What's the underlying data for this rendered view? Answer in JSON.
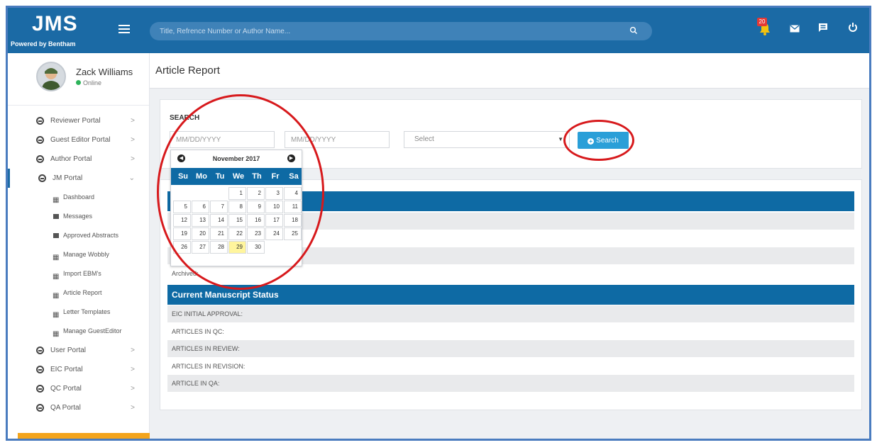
{
  "brand": {
    "title": "JMS",
    "subtitle": "Powered by Bentham"
  },
  "topbar": {
    "search_placeholder": "Title, Refrence Number or Author Name...",
    "icons": [
      "notification-icon",
      "mail-icon",
      "chat-icon",
      "power-icon"
    ],
    "notification_count": "20"
  },
  "user": {
    "name": "Zack Williams",
    "status": "Online"
  },
  "sidebar": {
    "items": [
      {
        "label": "Reviewer Portal",
        "chevron": ">"
      },
      {
        "label": "Guest Editor Portal",
        "chevron": ">"
      },
      {
        "label": "Author Portal",
        "chevron": ">"
      },
      {
        "label": "JM Portal",
        "chevron": "⌄"
      }
    ],
    "subitems": [
      {
        "label": "Dashboard"
      },
      {
        "label": "Messages"
      },
      {
        "label": "Approved Abstracts"
      },
      {
        "label": "Manage Wobbly"
      },
      {
        "label": "Import EBM's"
      },
      {
        "label": "Article Report"
      },
      {
        "label": "Letter Templates"
      },
      {
        "label": "Manage GuestEditor"
      }
    ],
    "bottom_items": [
      {
        "label": "User Portal",
        "chevron": ">"
      },
      {
        "label": "EIC Portal",
        "chevron": ">"
      },
      {
        "label": "QC Portal",
        "chevron": ">"
      },
      {
        "label": "QA Portal",
        "chevron": ">"
      }
    ]
  },
  "page": {
    "title": "Article Report"
  },
  "search": {
    "label": "SEARCH",
    "from_placeholder": "MM/DD/YYYY",
    "to_placeholder": "MM/DD/YYYY",
    "select_value": "Select",
    "button_label": "Search"
  },
  "calendar": {
    "month": "November 2017",
    "weekdays": [
      "Su",
      "Mo",
      "Tu",
      "We",
      "Th",
      "Fr",
      "Sa"
    ],
    "weeks": [
      [
        "",
        "",
        "",
        "1",
        "2",
        "3",
        "4"
      ],
      [
        "5",
        "6",
        "7",
        "8",
        "9",
        "10",
        "11"
      ],
      [
        "12",
        "13",
        "14",
        "15",
        "16",
        "17",
        "18"
      ],
      [
        "19",
        "20",
        "21",
        "22",
        "23",
        "24",
        "25"
      ],
      [
        "26",
        "27",
        "28",
        "29",
        "30",
        "",
        ""
      ]
    ],
    "highlighted": "29"
  },
  "report": {
    "archive_label": "Archived:",
    "status_title": "Current Manuscript Status",
    "status_rows": [
      "EIC INITIAL APPROVAL:",
      "ARTICLES IN QC:",
      "ARTICLES IN REVIEW:",
      "ARTICLES IN REVISION:",
      "ARTICLE IN QA:"
    ]
  },
  "colors": {
    "primary": "#1b6aa5",
    "band": "#0e6aa4",
    "button": "#2a9fd8",
    "annotation": "#d7191c",
    "highlight": "#fff59d"
  }
}
